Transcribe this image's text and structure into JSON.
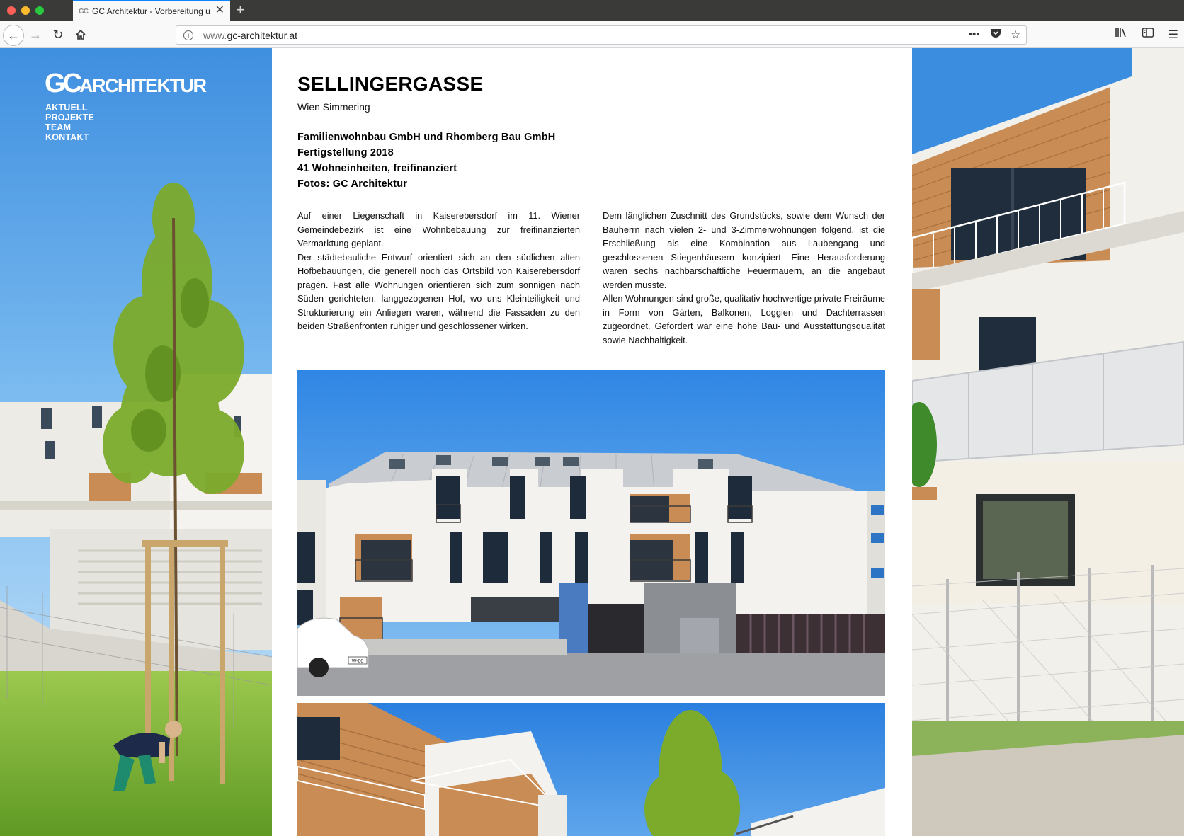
{
  "browser": {
    "tab_title": "GC Architektur - Vorbereitung u",
    "tab_favicon": "GC",
    "url_host": "www.",
    "url_domain": "gc-architektur.at",
    "icons": [
      "back-icon",
      "forward-icon",
      "reload-icon",
      "home-icon",
      "info-icon",
      "more-icon",
      "pocket-icon",
      "bookmark-star-icon",
      "library-icon",
      "sidebar-icon",
      "menu-icon"
    ]
  },
  "site": {
    "logo_gc": "GC",
    "logo_arch": "ARCHITEKTUR",
    "nav": [
      "AKTUELL",
      "PROJEKTE",
      "TEAM",
      "KONTAKT"
    ]
  },
  "project": {
    "title": "SELLINGERGASSE",
    "location": "Wien Simmering",
    "facts": [
      "Familienwohnbau GmbH und Rhomberg Bau GmbH",
      "Fertigstellung 2018",
      "41 Wohneinheiten, freifinanziert",
      "Fotos: GC Architektur"
    ],
    "col1": [
      "Auf einer Liegenschaft in Kaiserebersdorf im 11. Wiener Gemeindebezirk ist eine Wohnbebauung zur freifinanzierten Vermarktung geplant.",
      "Der städtebauliche Entwurf orientiert sich an den südlichen alten Hofbebauungen, die generell noch das Ortsbild von Kaiserebersdorf prägen. Fast alle Wohnungen orientieren sich zum sonnigen nach Süden gerichteten, langgezogenen Hof, wo uns Kleinteiligkeit und Strukturierung ein Anliegen waren, während die Fassaden zu den beiden Straßenfronten ruhiger und geschlossener wirken."
    ],
    "col2": [
      "Dem länglichen Zuschnitt des Grundstücks, sowie dem Wunsch der Bauherrn nach vielen 2- und 3-Zimmerwohnungen folgend, ist die Erschließung als eine Kombination aus Laubengang und geschlossenen Stiegenhäusern konzipiert. Eine Herausforderung waren sechs nachbarschaftliche Feuermauern, an die angebaut werden musste.",
      "Allen Wohnungen sind große, qualitativ hochwertige private Freiräume in Form von Gärten, Balkonen, Loggien und Dachterrassen zugeordnet. Gefordert war eine hohe Bau- und Ausstattungsqualität sowie Nachhaltigkeit."
    ],
    "car_plate": "W-00"
  },
  "colors": {
    "sky": "#5aa8e8",
    "grass": "#7bb536",
    "wood": "#c98c55",
    "facade": "#f3f2ee"
  }
}
